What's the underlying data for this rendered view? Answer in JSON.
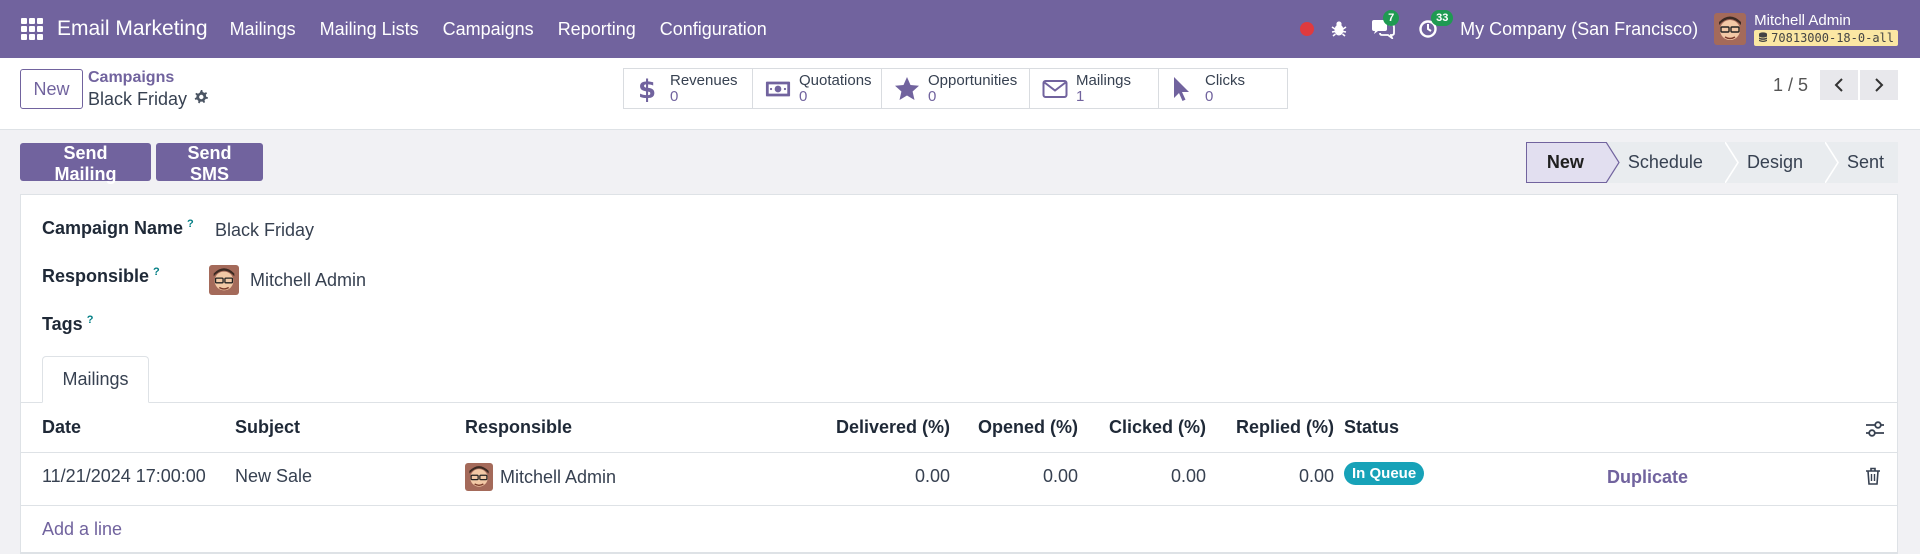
{
  "navbar": {
    "brand": "Email Marketing",
    "menu": [
      "Mailings",
      "Mailing Lists",
      "Campaigns",
      "Reporting",
      "Configuration"
    ],
    "messages_count": "7",
    "activities_count": "33",
    "company": "My Company (San Francisco)",
    "user_name": "Mitchell Admin",
    "db_name": "70813000-18-0-all"
  },
  "control": {
    "new_label": "New",
    "breadcrumb_parent": "Campaigns",
    "breadcrumb_current": "Black Friday",
    "stats": [
      {
        "label": "Revenues",
        "value": "0",
        "icon": "dollar-icon"
      },
      {
        "label": "Quotations",
        "value": "0",
        "icon": "money-icon"
      },
      {
        "label": "Opportunities",
        "value": "0",
        "icon": "star-icon"
      },
      {
        "label": "Mailings",
        "value": "1",
        "icon": "envelope-icon"
      },
      {
        "label": "Clicks",
        "value": "0",
        "icon": "cursor-icon"
      }
    ],
    "pager": "1 / 5"
  },
  "actions": {
    "send_mailing": "Send Mailing",
    "send_sms": "Send SMS",
    "stages": [
      "New",
      "Schedule",
      "Design",
      "Sent"
    ],
    "active_stage": "New"
  },
  "form": {
    "campaign_name_label": "Campaign Name",
    "campaign_name": "Black Friday",
    "responsible_label": "Responsible",
    "responsible": "Mitchell Admin",
    "tags_label": "Tags",
    "help_mark": "?",
    "tab_label": "Mailings"
  },
  "table": {
    "columns": [
      "Date",
      "Subject",
      "Responsible",
      "Delivered (%)",
      "Opened (%)",
      "Clicked (%)",
      "Replied (%)",
      "Status"
    ],
    "rows": [
      {
        "date": "11/21/2024 17:00:00",
        "subject": "New Sale",
        "responsible": "Mitchell Admin",
        "delivered": "0.00",
        "opened": "0.00",
        "clicked": "0.00",
        "replied": "0.00",
        "status": "In Queue",
        "duplicate": "Duplicate"
      }
    ],
    "add_line": "Add a line"
  },
  "colors": {
    "brand": "#71639e",
    "status_badge": "#17a2b8",
    "badge_green": "#1f9a52"
  }
}
